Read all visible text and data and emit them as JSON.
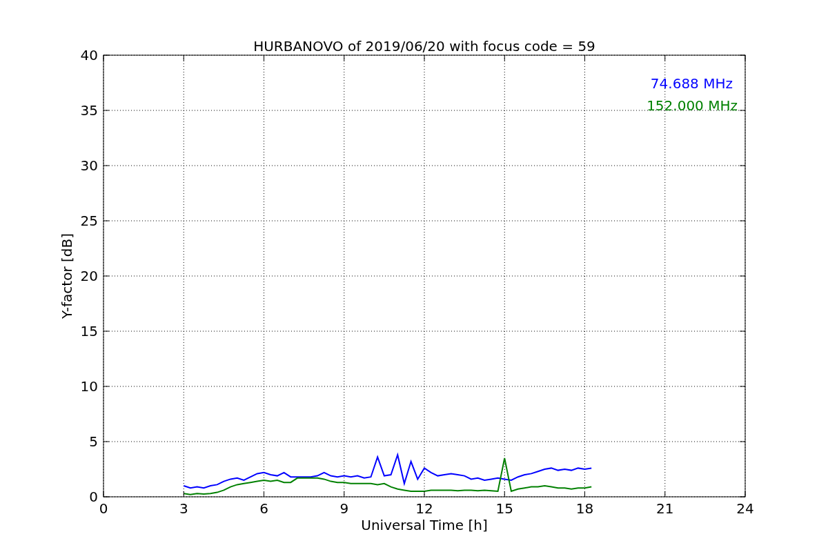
{
  "chart_data": {
    "type": "line",
    "title": "HURBANOVO of 2019/06/20 with focus code = 59",
    "xlabel": "Universal Time [h]",
    "ylabel": "Y-factor [dB]",
    "x": [
      3,
      3.25,
      3.5,
      3.75,
      4,
      4.25,
      4.5,
      4.75,
      5,
      5.25,
      5.5,
      5.75,
      6,
      6.25,
      6.5,
      6.75,
      7,
      7.25,
      7.5,
      7.75,
      8,
      8.25,
      8.5,
      8.75,
      9,
      9.25,
      9.5,
      9.75,
      10,
      10.25,
      10.5,
      10.75,
      11,
      11.25,
      11.5,
      11.75,
      12,
      12.25,
      12.5,
      12.75,
      13,
      13.25,
      13.5,
      13.75,
      14,
      14.25,
      14.5,
      14.75,
      15,
      15.25,
      15.5,
      15.75,
      16,
      16.25,
      16.5,
      16.75,
      17,
      17.25,
      17.5,
      17.75,
      18,
      18.25
    ],
    "series": [
      {
        "name": "74.688 MHz",
        "color": "#0000ff",
        "values": [
          1.0,
          0.8,
          0.9,
          0.8,
          1.0,
          1.1,
          1.4,
          1.6,
          1.7,
          1.5,
          1.8,
          2.1,
          2.2,
          2.0,
          1.9,
          2.2,
          1.8,
          1.8,
          1.8,
          1.8,
          1.9,
          2.2,
          1.9,
          1.8,
          1.9,
          1.8,
          1.9,
          1.7,
          1.8,
          3.6,
          1.9,
          2.0,
          3.8,
          1.2,
          3.2,
          1.6,
          2.6,
          2.2,
          1.9,
          2.0,
          2.1,
          2.0,
          1.9,
          1.6,
          1.7,
          1.5,
          1.6,
          1.7,
          1.6,
          1.5,
          1.8,
          2.0,
          2.1,
          2.3,
          2.5,
          2.6,
          2.4,
          2.5,
          2.4,
          2.6,
          2.5,
          2.6
        ]
      },
      {
        "name": "152.000 MHz",
        "color": "#008000",
        "values": [
          0.3,
          0.2,
          0.3,
          0.25,
          0.3,
          0.4,
          0.6,
          0.9,
          1.1,
          1.2,
          1.3,
          1.4,
          1.5,
          1.4,
          1.5,
          1.3,
          1.3,
          1.7,
          1.7,
          1.7,
          1.7,
          1.6,
          1.4,
          1.3,
          1.3,
          1.2,
          1.2,
          1.2,
          1.2,
          1.1,
          1.2,
          0.9,
          0.7,
          0.6,
          0.5,
          0.5,
          0.5,
          0.6,
          0.6,
          0.6,
          0.6,
          0.55,
          0.6,
          0.6,
          0.55,
          0.6,
          0.55,
          0.5,
          3.5,
          0.5,
          0.7,
          0.8,
          0.9,
          0.9,
          1.0,
          0.9,
          0.8,
          0.8,
          0.7,
          0.8,
          0.8,
          0.9
        ]
      }
    ],
    "grid": true,
    "xlim": [
      0,
      24
    ],
    "ylim": [
      0,
      40
    ],
    "xticks": [
      0,
      3,
      6,
      9,
      12,
      15,
      18,
      21,
      24
    ],
    "yticks": [
      0,
      5,
      10,
      15,
      20,
      25,
      30,
      35,
      40
    ]
  }
}
